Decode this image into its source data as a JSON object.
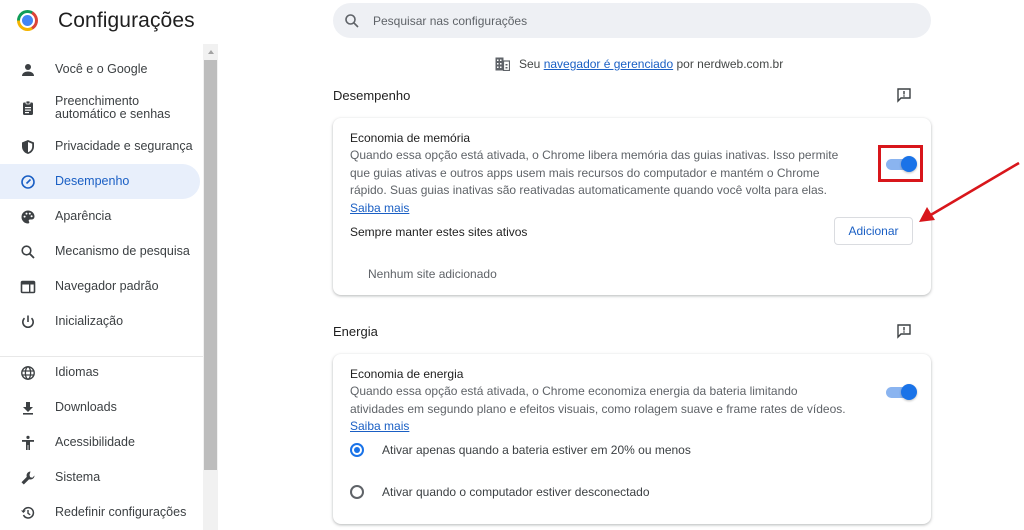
{
  "header": {
    "app_title": "Configurações",
    "search_placeholder": "Pesquisar nas configurações"
  },
  "sidebar": {
    "items": [
      {
        "label": "Você e o Google",
        "icon": "person-icon"
      },
      {
        "label": "Preenchimento automático e senhas",
        "icon": "clipboard-icon"
      },
      {
        "label": "Privacidade e segurança",
        "icon": "shield-icon"
      },
      {
        "label": "Desempenho",
        "icon": "speedometer-icon",
        "active": true
      },
      {
        "label": "Aparência",
        "icon": "palette-icon"
      },
      {
        "label": "Mecanismo de pesquisa",
        "icon": "search-icon"
      },
      {
        "label": "Navegador padrão",
        "icon": "browser-window-icon"
      },
      {
        "label": "Inicialização",
        "icon": "power-icon"
      },
      {
        "label": "Idiomas",
        "icon": "globe-icon"
      },
      {
        "label": "Downloads",
        "icon": "download-icon"
      },
      {
        "label": "Acessibilidade",
        "icon": "accessibility-icon"
      },
      {
        "label": "Sistema",
        "icon": "wrench-icon"
      },
      {
        "label": "Redefinir configurações",
        "icon": "history-icon"
      }
    ]
  },
  "managed_notice": {
    "prefix": "Seu",
    "link": "navegador é gerenciado",
    "suffix": "por nerdweb.com.br"
  },
  "sections": {
    "performance": {
      "title": "Desempenho",
      "memory_saver": {
        "title": "Economia de memória",
        "description": "Quando essa opção está ativada, o Chrome libera memória das guias inativas. Isso permite que guias ativas e outros apps usem mais recursos do computador e mantém o Chrome rápido. Suas guias inativas são reativadas automaticamente quando você volta para elas.",
        "learn_more": "Saiba mais",
        "enabled": true
      },
      "always_active": {
        "title": "Sempre manter estes sites ativos",
        "add_button": "Adicionar",
        "empty_text": "Nenhum site adicionado"
      }
    },
    "energy": {
      "title": "Energia",
      "energy_saver": {
        "title": "Economia de energia",
        "description": "Quando essa opção está ativada, o Chrome economiza energia da bateria limitando atividades em segundo plano e efeitos visuais, como rolagem suave e frame rates de vídeos.",
        "learn_more": "Saiba mais",
        "enabled": true
      },
      "options": [
        {
          "label": "Ativar apenas quando a bateria estiver em 20% ou menos",
          "checked": true
        },
        {
          "label": "Ativar quando o computador estiver desconectado",
          "checked": false
        }
      ]
    }
  },
  "colors": {
    "accent": "#1a73e8",
    "annotation": "#d8161b",
    "active_nav_bg": "#e8effb"
  }
}
